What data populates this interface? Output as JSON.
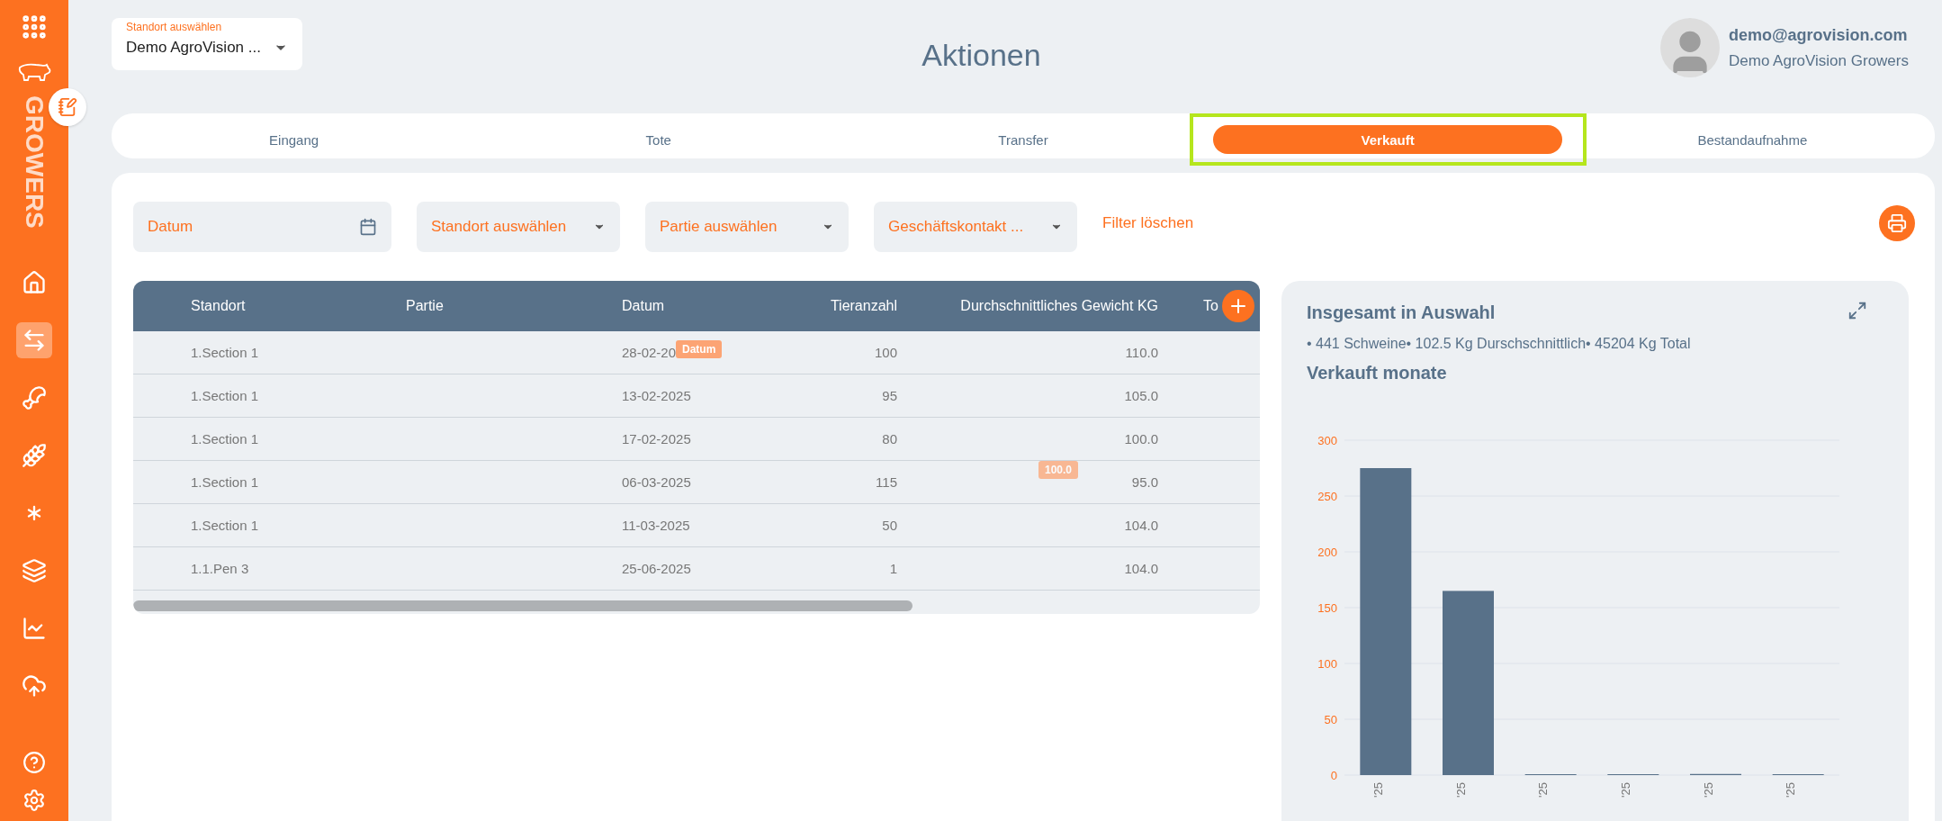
{
  "sidebar": {
    "brand": "GROWERS",
    "items": [
      {
        "kind": "home",
        "selected": false
      },
      {
        "kind": "transfer",
        "selected": true
      },
      {
        "kind": "meat",
        "selected": false
      },
      {
        "kind": "grain",
        "selected": false
      },
      {
        "kind": "asterisk",
        "selected": false
      },
      {
        "kind": "layers",
        "selected": false
      },
      {
        "kind": "chart",
        "selected": false
      },
      {
        "kind": "upload",
        "selected": false
      }
    ]
  },
  "location_select": {
    "label": "Standort auswählen",
    "value": "Demo AgroVision ..."
  },
  "title": "Aktionen",
  "user": {
    "email": "demo@agrovision.com",
    "company": "Demo AgroVision Growers"
  },
  "tabs": [
    {
      "label": "Eingang",
      "selected": false,
      "highlighted": false
    },
    {
      "label": "Tote",
      "selected": false,
      "highlighted": false
    },
    {
      "label": "Transfer",
      "selected": false,
      "highlighted": false
    },
    {
      "label": "Verkauft",
      "selected": true,
      "highlighted": true
    },
    {
      "label": "Bestandaufnahme",
      "selected": false,
      "highlighted": false
    }
  ],
  "filters": [
    {
      "kind": "date",
      "placeholder": "Datum"
    },
    {
      "kind": "select",
      "placeholder": "Standort auswählen"
    },
    {
      "kind": "select",
      "placeholder": "Partie auswählen"
    },
    {
      "kind": "select",
      "placeholder": "Geschäftskontakt ..."
    }
  ],
  "clear_filters": "Filter löschen",
  "table": {
    "columns": [
      "Standort",
      "Partie",
      "Datum",
      "Tieranzahl",
      "Durchschnittliches Gewicht KG",
      "To"
    ],
    "rows": [
      {
        "standort": "1.Section 1",
        "datum": "28-02-20",
        "datum_tooltip": "Datum",
        "tieranzahl": "100",
        "gewicht": "110.0"
      },
      {
        "standort": "1.Section 1",
        "datum": "13-02-2025",
        "tieranzahl": "95",
        "gewicht": "105.0"
      },
      {
        "standort": "1.Section 1",
        "datum": "17-02-2025",
        "tieranzahl": "80",
        "gewicht": "100.0"
      },
      {
        "standort": "1.Section 1",
        "datum": "06-03-2025",
        "tieranzahl": "115",
        "gewicht": "95.0",
        "gewicht_tooltip": "100.0"
      },
      {
        "standort": "1.Section 1",
        "datum": "11-03-2025",
        "tieranzahl": "50",
        "gewicht": "104.0"
      },
      {
        "standort": "1.1.Pen 3",
        "datum": "25-06-2025",
        "tieranzahl": "1",
        "gewicht": "104.0"
      }
    ]
  },
  "summary": {
    "title": "Insgesamt in Auswahl",
    "stats": "• 441 Schweine• 102.5 Kg Durschschnittlich• 45204 Kg Total",
    "chart_title": "Verkauft monate",
    "chart_data": {
      "type": "bar",
      "categories": [
        "'25",
        "'25",
        "'25",
        "'25",
        "'25",
        "'25"
      ],
      "series": [
        {
          "color": "#587189",
          "values": [
            275,
            165,
            0,
            0,
            1,
            0
          ]
        }
      ],
      "grid": true,
      "ylim": [
        0,
        300
      ],
      "yticks": [
        0,
        50,
        100,
        150,
        200,
        250,
        300
      ]
    }
  }
}
